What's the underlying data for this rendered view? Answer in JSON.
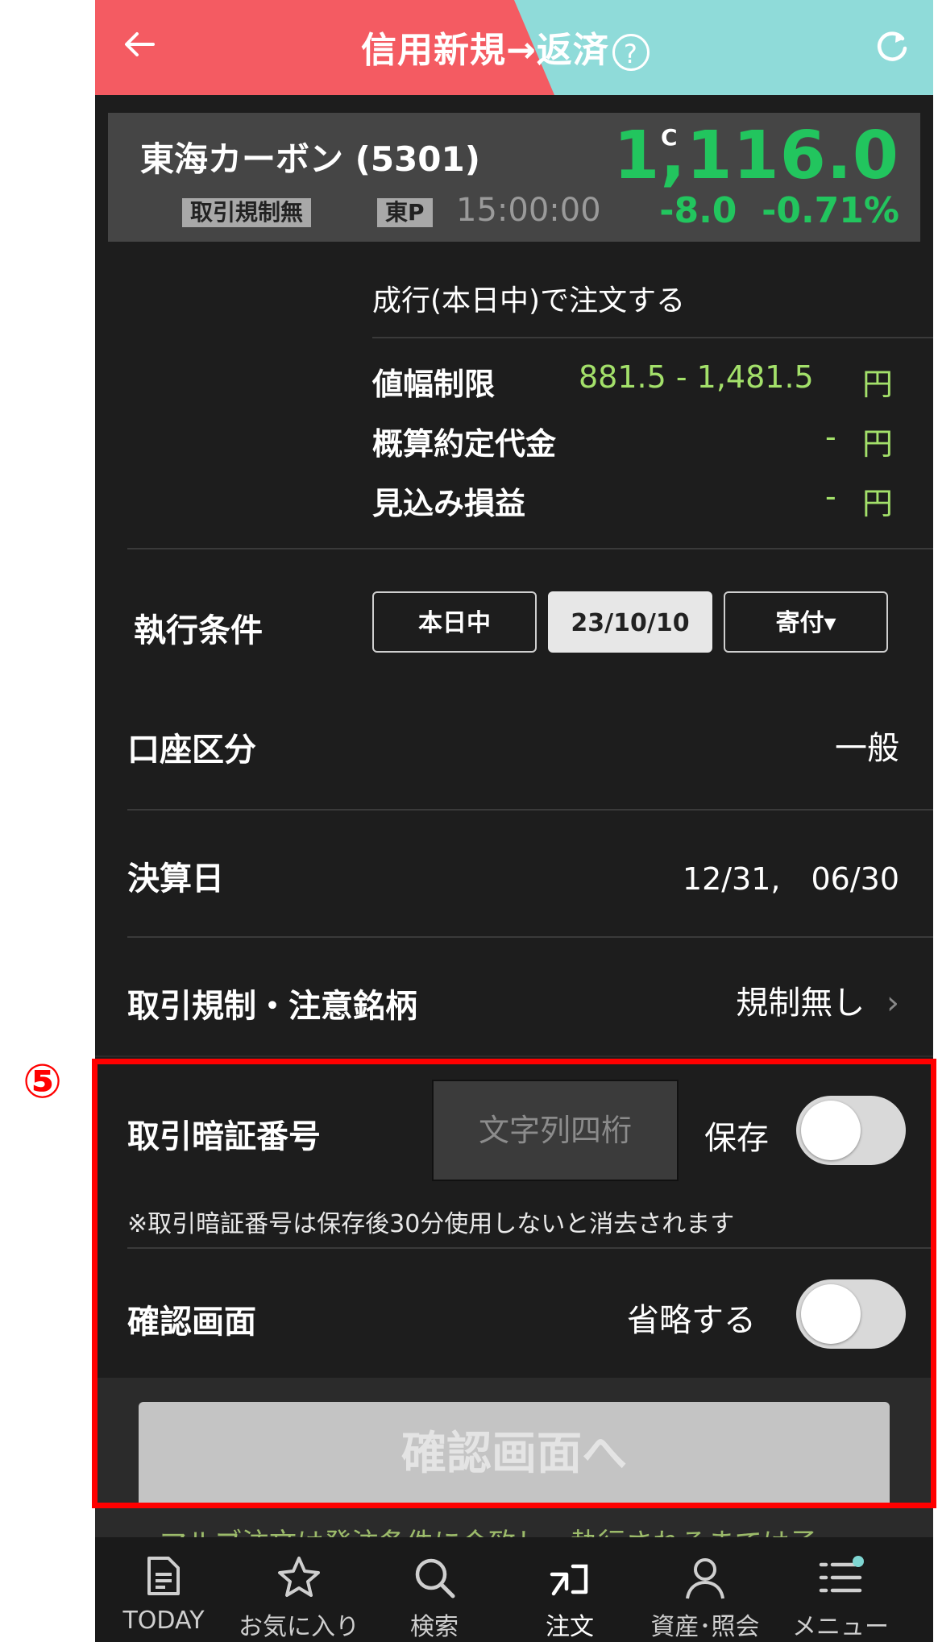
{
  "header": {
    "title": "信用新規→返済",
    "help_symbol": "?",
    "colors": {
      "left": "#f45b62",
      "right": "#8fdbd9"
    }
  },
  "stock": {
    "name": "東海カーボン (5301)",
    "regulation_badge": "取引規制無",
    "market_badge": "東P",
    "time": "15:00:00",
    "price_flag": "C",
    "price": "1,116.0",
    "change": "-8.0",
    "change_pct": "-0.71%"
  },
  "order": {
    "market_order_text": "成行(本日中)で注文する",
    "price_limit_label": "値幅制限",
    "price_limit_value": "881.5 - 1,481.5",
    "estimated_amount_label": "概算約定代金",
    "estimated_amount_value": "-",
    "expected_pl_label": "見込み損益",
    "expected_pl_value": "-",
    "yen": "円"
  },
  "execution": {
    "label": "執行条件",
    "buttons": [
      "本日中",
      "23/10/10",
      "寄付▾"
    ],
    "selected": "23/10/10"
  },
  "account": {
    "label": "口座区分",
    "value": "一般"
  },
  "settlement": {
    "label": "決算日",
    "value": "12/31,　06/30"
  },
  "regulation": {
    "label": "取引規制・注意銘柄",
    "value": "規制無し",
    "chevron": "›"
  },
  "pin": {
    "label": "取引暗証番号",
    "placeholder": "文字列四桁",
    "save_label": "保存",
    "save_on": false,
    "note": "※取引暗証番号は保存後30分使用しないと消去されます"
  },
  "confirm": {
    "label": "確認画面",
    "skip_label": "省略する",
    "skip_on": false,
    "button": "確認画面へ"
  },
  "annotation": {
    "marker": "⑤"
  },
  "peek_text": "マルブ注文は発注条件に合致し、執行されるまでは子",
  "nav": [
    {
      "label": "TODAY",
      "icon": "today-icon"
    },
    {
      "label": "お気に入り",
      "icon": "star-icon"
    },
    {
      "label": "検索",
      "icon": "search-icon"
    },
    {
      "label": "注文",
      "icon": "order-icon"
    },
    {
      "label": "資産･照会",
      "icon": "person-icon"
    },
    {
      "label": "メニュー",
      "icon": "menu-icon"
    }
  ]
}
